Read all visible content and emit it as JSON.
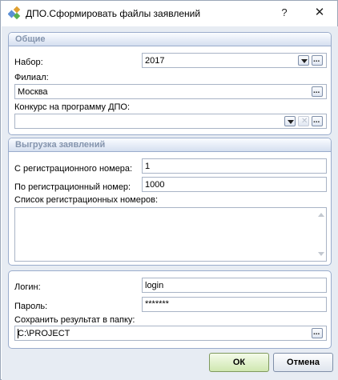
{
  "window": {
    "title": "ДПО.Сформировать файлы заявлений",
    "help_label": "?",
    "close_label": "✕"
  },
  "general": {
    "title": "Общие",
    "set_label": "Набор:",
    "set_value": "2017",
    "branch_label": "Филиал:",
    "branch_value": "Москва",
    "contest_label": "Конкурс на программу ДПО:",
    "contest_value": ""
  },
  "upload": {
    "title": "Выгрузка заявлений",
    "from_label": "С регистрационного номера:",
    "from_value": "1",
    "to_label": "По регистрационный номер:",
    "to_value": "1000",
    "list_label": "Список регистрационных номеров:",
    "list_value": ""
  },
  "credentials": {
    "login_label": "Логин:",
    "login_value": "login",
    "password_label": "Пароль:",
    "password_value": "*******",
    "folder_label": "Сохранить результат в папку:",
    "folder_value": "C:\\PROJECT"
  },
  "buttons": {
    "ok_label": "ОК",
    "cancel_label": "Отмена"
  },
  "icons": {
    "ellipsis": "...",
    "clear": "✕"
  }
}
